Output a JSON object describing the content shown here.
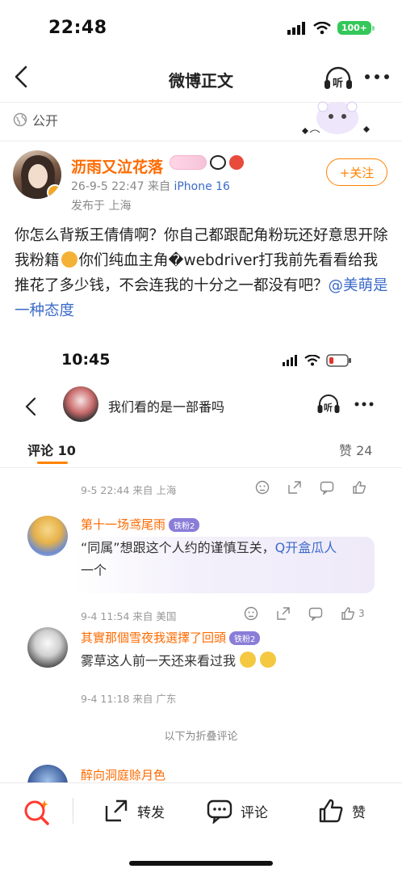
{
  "status_bar": {
    "time": "22:48",
    "battery": "100+"
  },
  "nav": {
    "title": "微博正文",
    "listen_label": "听"
  },
  "visibility": {
    "label": "公开"
  },
  "post": {
    "author": "沥雨又泣花落",
    "meta_time": "26-9-5 22:47",
    "meta_from": "来自",
    "meta_device": "iPhone 16",
    "location": "发布于 上海",
    "follow_label": "+关注",
    "content_part1": "你怎么背叛王倩倩啊？你自己都跟配角粉玩还好意思开除我粉籍",
    "content_part2": "你们纯血主角�webdriver打我前先看看给我推花了多少钱，不会连我的十分之一都没有吧？",
    "mention": "@美萌是一种态度"
  },
  "embedded": {
    "time": "10:45",
    "title": "我们看的是一部番吗",
    "listen_label": "听",
    "tab_comments": "评论 10",
    "tab_likes": "赞 24",
    "comments": [
      {
        "time_loc": "9-5 22:44 来自 上海"
      },
      {
        "name": "第十一场鸢尾雨",
        "badge": "铁粉2",
        "text": "“同属”想跟这个人约的谨慎互关，",
        "link": "Q开盒瓜人",
        "text2": "一个",
        "time_loc": "9-4 11:54 来自 美国",
        "likes": "3"
      },
      {
        "name": "其實那個雪夜我選擇了回頭",
        "badge": "铁粉2",
        "text": "雾草这人前一天还来看过我",
        "time_loc": "9-4 11:18 来自 广东"
      },
      {
        "name": "醉向洞庭赊月色"
      }
    ],
    "folded_label": "以下为折叠评论"
  },
  "bottom_bar": {
    "repost": "转发",
    "comment": "评论",
    "like": "赞"
  },
  "colors": {
    "accent": "#ff8200",
    "name": "#ff6a00",
    "link": "#3b6bc9"
  }
}
